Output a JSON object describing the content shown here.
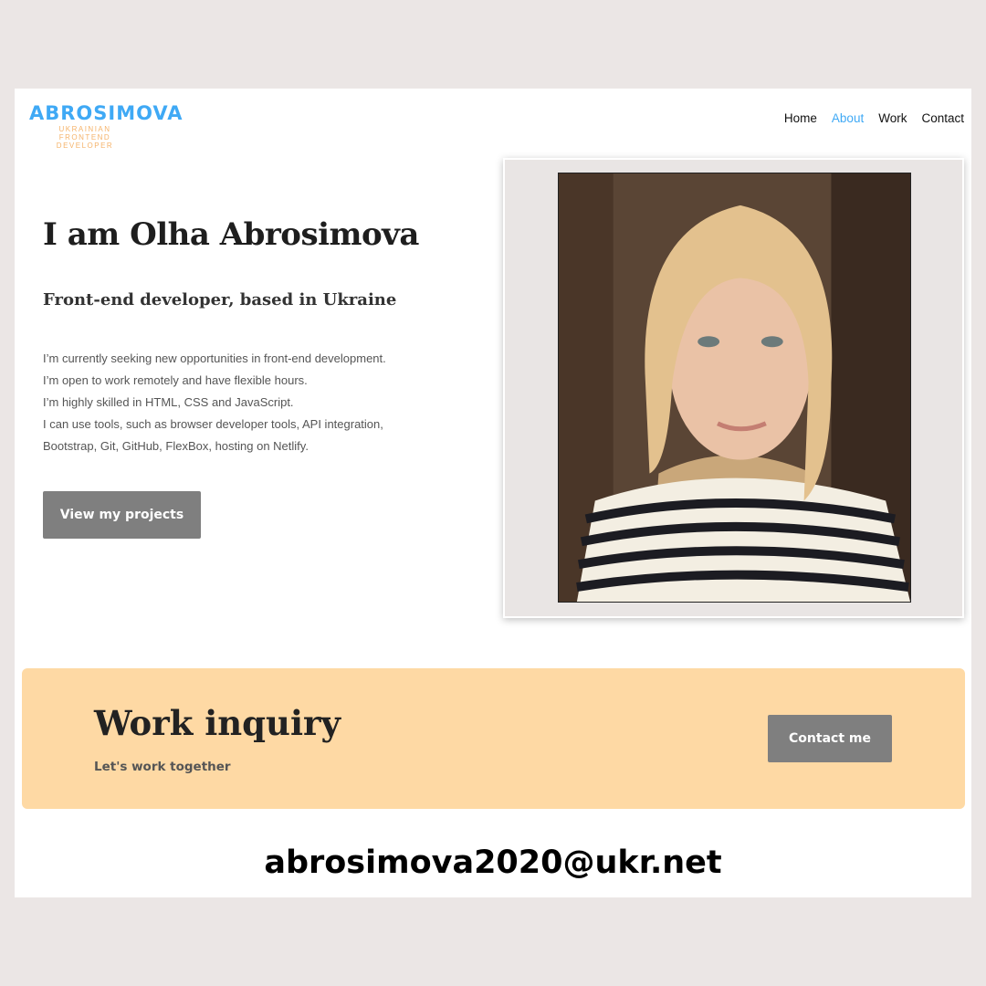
{
  "logo": {
    "title": "ABROSIMOVA",
    "subtitle": "UKRAINIAN FRONTEND DEVELOPER"
  },
  "nav": {
    "items": [
      "Home",
      "About",
      "Work",
      "Contact"
    ],
    "active": "About",
    "active_color": "#3fa9f5"
  },
  "hero": {
    "title": "I am Olha Abrosimova",
    "subtitle": "Front-end developer, based in Ukraine",
    "description": [
      "I’m currently seeking new opportunities in front-end development.",
      "I’m open to work remotely and have flexible hours.",
      "I’m highly skilled in HTML, CSS and JavaScript.",
      "I can use tools, such as browser developer tools, API integration,",
      "Bootstrap, Git, GitHub, FlexBox, hosting on Netlify."
    ],
    "button_label": "View my projects"
  },
  "inquiry": {
    "title": "Work inquiry",
    "subtitle": "Let's work together",
    "button_label": "Contact me",
    "background_color": "#fed9a4"
  },
  "contact": {
    "email": "abrosimova2020@ukr.net"
  },
  "colors": {
    "button": "#7f7f7f",
    "logo_blue": "#3fa9f5",
    "logo_orange": "#f5b36a",
    "outer_background": "#ebe6e5"
  }
}
